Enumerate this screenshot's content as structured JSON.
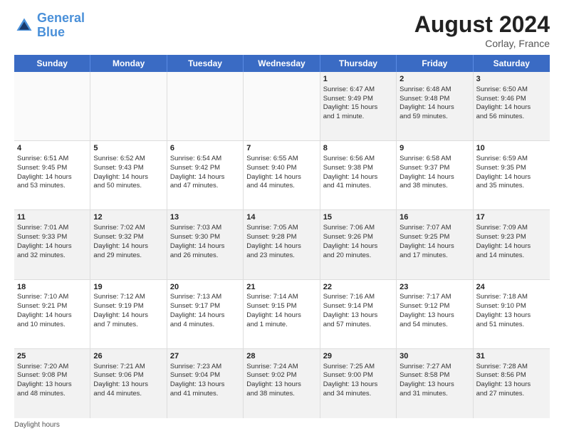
{
  "logo": {
    "line1": "General",
    "line2": "Blue"
  },
  "title": "August 2024",
  "location": "Corlay, France",
  "days": [
    "Sunday",
    "Monday",
    "Tuesday",
    "Wednesday",
    "Thursday",
    "Friday",
    "Saturday"
  ],
  "footer": "Daylight hours",
  "weeks": [
    [
      {
        "day": "",
        "info": "",
        "empty": true
      },
      {
        "day": "",
        "info": "",
        "empty": true
      },
      {
        "day": "",
        "info": "",
        "empty": true
      },
      {
        "day": "",
        "info": "",
        "empty": true
      },
      {
        "day": "1",
        "info": "Sunrise: 6:47 AM\nSunset: 9:49 PM\nDaylight: 15 hours\nand 1 minute."
      },
      {
        "day": "2",
        "info": "Sunrise: 6:48 AM\nSunset: 9:48 PM\nDaylight: 14 hours\nand 59 minutes."
      },
      {
        "day": "3",
        "info": "Sunrise: 6:50 AM\nSunset: 9:46 PM\nDaylight: 14 hours\nand 56 minutes."
      }
    ],
    [
      {
        "day": "4",
        "info": "Sunrise: 6:51 AM\nSunset: 9:45 PM\nDaylight: 14 hours\nand 53 minutes."
      },
      {
        "day": "5",
        "info": "Sunrise: 6:52 AM\nSunset: 9:43 PM\nDaylight: 14 hours\nand 50 minutes."
      },
      {
        "day": "6",
        "info": "Sunrise: 6:54 AM\nSunset: 9:42 PM\nDaylight: 14 hours\nand 47 minutes."
      },
      {
        "day": "7",
        "info": "Sunrise: 6:55 AM\nSunset: 9:40 PM\nDaylight: 14 hours\nand 44 minutes."
      },
      {
        "day": "8",
        "info": "Sunrise: 6:56 AM\nSunset: 9:38 PM\nDaylight: 14 hours\nand 41 minutes."
      },
      {
        "day": "9",
        "info": "Sunrise: 6:58 AM\nSunset: 9:37 PM\nDaylight: 14 hours\nand 38 minutes."
      },
      {
        "day": "10",
        "info": "Sunrise: 6:59 AM\nSunset: 9:35 PM\nDaylight: 14 hours\nand 35 minutes."
      }
    ],
    [
      {
        "day": "11",
        "info": "Sunrise: 7:01 AM\nSunset: 9:33 PM\nDaylight: 14 hours\nand 32 minutes."
      },
      {
        "day": "12",
        "info": "Sunrise: 7:02 AM\nSunset: 9:32 PM\nDaylight: 14 hours\nand 29 minutes."
      },
      {
        "day": "13",
        "info": "Sunrise: 7:03 AM\nSunset: 9:30 PM\nDaylight: 14 hours\nand 26 minutes."
      },
      {
        "day": "14",
        "info": "Sunrise: 7:05 AM\nSunset: 9:28 PM\nDaylight: 14 hours\nand 23 minutes."
      },
      {
        "day": "15",
        "info": "Sunrise: 7:06 AM\nSunset: 9:26 PM\nDaylight: 14 hours\nand 20 minutes."
      },
      {
        "day": "16",
        "info": "Sunrise: 7:07 AM\nSunset: 9:25 PM\nDaylight: 14 hours\nand 17 minutes."
      },
      {
        "day": "17",
        "info": "Sunrise: 7:09 AM\nSunset: 9:23 PM\nDaylight: 14 hours\nand 14 minutes."
      }
    ],
    [
      {
        "day": "18",
        "info": "Sunrise: 7:10 AM\nSunset: 9:21 PM\nDaylight: 14 hours\nand 10 minutes."
      },
      {
        "day": "19",
        "info": "Sunrise: 7:12 AM\nSunset: 9:19 PM\nDaylight: 14 hours\nand 7 minutes."
      },
      {
        "day": "20",
        "info": "Sunrise: 7:13 AM\nSunset: 9:17 PM\nDaylight: 14 hours\nand 4 minutes."
      },
      {
        "day": "21",
        "info": "Sunrise: 7:14 AM\nSunset: 9:15 PM\nDaylight: 14 hours\nand 1 minute."
      },
      {
        "day": "22",
        "info": "Sunrise: 7:16 AM\nSunset: 9:14 PM\nDaylight: 13 hours\nand 57 minutes."
      },
      {
        "day": "23",
        "info": "Sunrise: 7:17 AM\nSunset: 9:12 PM\nDaylight: 13 hours\nand 54 minutes."
      },
      {
        "day": "24",
        "info": "Sunrise: 7:18 AM\nSunset: 9:10 PM\nDaylight: 13 hours\nand 51 minutes."
      }
    ],
    [
      {
        "day": "25",
        "info": "Sunrise: 7:20 AM\nSunset: 9:08 PM\nDaylight: 13 hours\nand 48 minutes."
      },
      {
        "day": "26",
        "info": "Sunrise: 7:21 AM\nSunset: 9:06 PM\nDaylight: 13 hours\nand 44 minutes."
      },
      {
        "day": "27",
        "info": "Sunrise: 7:23 AM\nSunset: 9:04 PM\nDaylight: 13 hours\nand 41 minutes."
      },
      {
        "day": "28",
        "info": "Sunrise: 7:24 AM\nSunset: 9:02 PM\nDaylight: 13 hours\nand 38 minutes."
      },
      {
        "day": "29",
        "info": "Sunrise: 7:25 AM\nSunset: 9:00 PM\nDaylight: 13 hours\nand 34 minutes."
      },
      {
        "day": "30",
        "info": "Sunrise: 7:27 AM\nSunset: 8:58 PM\nDaylight: 13 hours\nand 31 minutes."
      },
      {
        "day": "31",
        "info": "Sunrise: 7:28 AM\nSunset: 8:56 PM\nDaylight: 13 hours\nand 27 minutes."
      }
    ]
  ]
}
